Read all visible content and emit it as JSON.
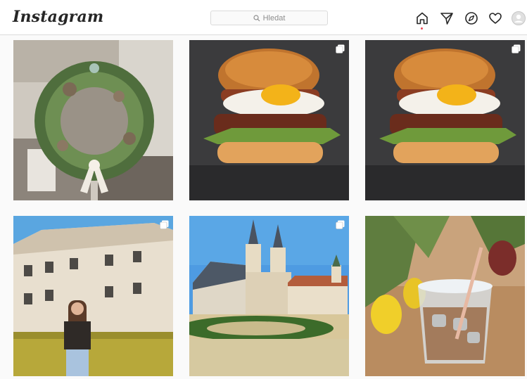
{
  "app": {
    "logo_text": "Instagram"
  },
  "search": {
    "placeholder": "Hledat"
  },
  "nav": {
    "icons": [
      "home-icon",
      "direct-messages-icon",
      "explore-compass-icon",
      "activity-heart-icon",
      "profile-avatar-icon"
    ]
  },
  "colors": {
    "border": "#dbdbdb",
    "notification_dot": "#ed4956",
    "text": "#262626",
    "muted": "#8e8e8e"
  },
  "posts": [
    {
      "subject": "christmas-wreath",
      "multi": false
    },
    {
      "subject": "burger-with-egg",
      "multi": true
    },
    {
      "subject": "burger-with-egg",
      "multi": true
    },
    {
      "subject": "chateau-with-woman",
      "multi": true
    },
    {
      "subject": "church-and-garden",
      "multi": true
    },
    {
      "subject": "iced-coffee-and-tulips",
      "multi": false
    }
  ]
}
